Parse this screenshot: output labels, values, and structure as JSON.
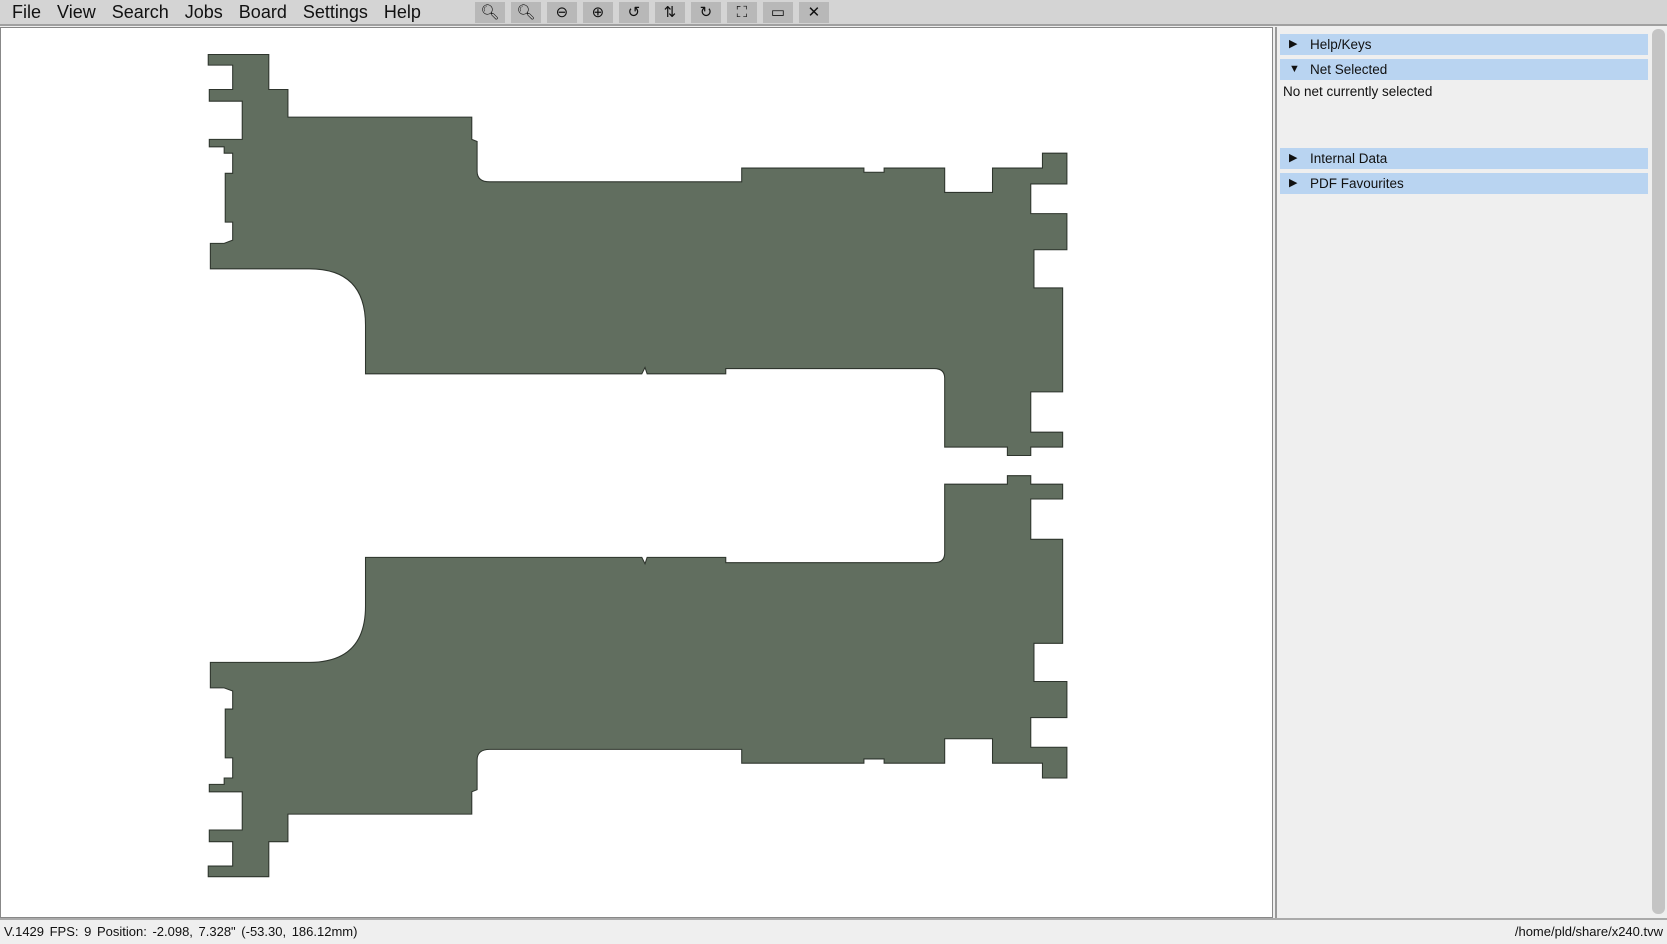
{
  "menu": [
    "File",
    "View",
    "Search",
    "Jobs",
    "Board",
    "Settings",
    "Help"
  ],
  "toolbar": [
    {
      "name": "zoom-out-icon",
      "glyph": "🔍︎"
    },
    {
      "name": "zoom-in-icon",
      "glyph": "🔍︎"
    },
    {
      "name": "minus-circle-icon",
      "glyph": "⊖"
    },
    {
      "name": "plus-circle-icon",
      "glyph": "⊕"
    },
    {
      "name": "rotate-ccw-icon",
      "glyph": "↺"
    },
    {
      "name": "flip-icon",
      "glyph": "⇅"
    },
    {
      "name": "rotate-cw-icon",
      "glyph": "↻"
    },
    {
      "name": "fit-to-screen-icon",
      "glyph": "⛶"
    },
    {
      "name": "board-outline-icon",
      "glyph": "▭"
    },
    {
      "name": "close-icon",
      "glyph": "✕"
    }
  ],
  "panel": {
    "sections": [
      {
        "label": "Help/Keys",
        "expanded": false
      },
      {
        "label": "Net Selected",
        "expanded": true
      },
      {
        "label": "Internal Data",
        "expanded": false
      },
      {
        "label": "PDF Favourites",
        "expanded": false
      }
    ],
    "net_selected_text": "No net currently selected"
  },
  "status": {
    "left": "V.1429  FPS: 9   Position: -2.098, 7.328\" (-53.30, 186.12mm)",
    "right": "/home/pld/share/x240.tvw"
  },
  "colors": {
    "board": "#616e5f",
    "section": "#b9d4f1"
  }
}
